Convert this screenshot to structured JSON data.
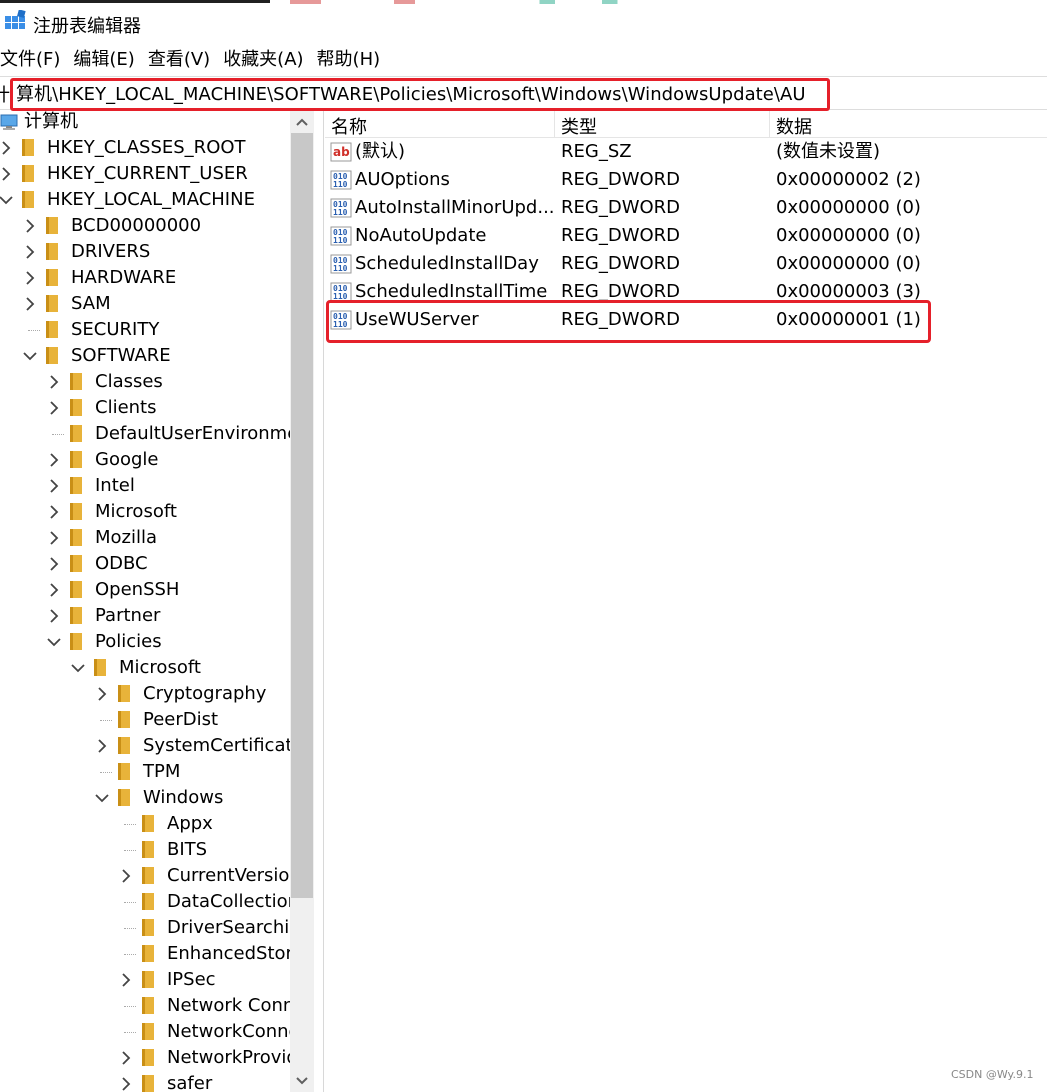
{
  "window": {
    "title": "注册表编辑器"
  },
  "menu": [
    "文件(F)",
    "编辑(E)",
    "查看(V)",
    "收藏夹(A)",
    "帮助(H)"
  ],
  "address": {
    "prefix": "计",
    "path": "算机\\HKEY_LOCAL_MACHINE\\SOFTWARE\\Policies\\Microsoft\\Windows\\WindowsUpdate\\AU"
  },
  "tree": {
    "root": "计算机",
    "nodes": [
      {
        "label": "HKEY_CLASSES_ROOT",
        "depth": 0,
        "expander": "collapsed"
      },
      {
        "label": "HKEY_CURRENT_USER",
        "depth": 0,
        "expander": "collapsed"
      },
      {
        "label": "HKEY_LOCAL_MACHINE",
        "depth": 0,
        "expander": "expanded"
      },
      {
        "label": "BCD00000000",
        "depth": 1,
        "expander": "collapsed"
      },
      {
        "label": "DRIVERS",
        "depth": 1,
        "expander": "collapsed"
      },
      {
        "label": "HARDWARE",
        "depth": 1,
        "expander": "collapsed"
      },
      {
        "label": "SAM",
        "depth": 1,
        "expander": "collapsed"
      },
      {
        "label": "SECURITY",
        "depth": 1,
        "expander": "none"
      },
      {
        "label": "SOFTWARE",
        "depth": 1,
        "expander": "expanded"
      },
      {
        "label": "Classes",
        "depth": 2,
        "expander": "collapsed"
      },
      {
        "label": "Clients",
        "depth": 2,
        "expander": "collapsed"
      },
      {
        "label": "DefaultUserEnvironment",
        "depth": 2,
        "expander": "none"
      },
      {
        "label": "Google",
        "depth": 2,
        "expander": "collapsed"
      },
      {
        "label": "Intel",
        "depth": 2,
        "expander": "collapsed"
      },
      {
        "label": "Microsoft",
        "depth": 2,
        "expander": "collapsed"
      },
      {
        "label": "Mozilla",
        "depth": 2,
        "expander": "collapsed"
      },
      {
        "label": "ODBC",
        "depth": 2,
        "expander": "collapsed"
      },
      {
        "label": "OpenSSH",
        "depth": 2,
        "expander": "collapsed"
      },
      {
        "label": "Partner",
        "depth": 2,
        "expander": "collapsed"
      },
      {
        "label": "Policies",
        "depth": 2,
        "expander": "expanded"
      },
      {
        "label": "Microsoft",
        "depth": 3,
        "expander": "expanded"
      },
      {
        "label": "Cryptography",
        "depth": 4,
        "expander": "collapsed"
      },
      {
        "label": "PeerDist",
        "depth": 4,
        "expander": "none"
      },
      {
        "label": "SystemCertificates",
        "depth": 4,
        "expander": "collapsed"
      },
      {
        "label": "TPM",
        "depth": 4,
        "expander": "none"
      },
      {
        "label": "Windows",
        "depth": 4,
        "expander": "expanded"
      },
      {
        "label": "Appx",
        "depth": 5,
        "expander": "none"
      },
      {
        "label": "BITS",
        "depth": 5,
        "expander": "none"
      },
      {
        "label": "CurrentVersion",
        "depth": 5,
        "expander": "collapsed"
      },
      {
        "label": "DataCollection",
        "depth": 5,
        "expander": "none"
      },
      {
        "label": "DriverSearching",
        "depth": 5,
        "expander": "none"
      },
      {
        "label": "EnhancedStorageDevices",
        "depth": 5,
        "expander": "none"
      },
      {
        "label": "IPSec",
        "depth": 5,
        "expander": "collapsed"
      },
      {
        "label": "Network Connections",
        "depth": 5,
        "expander": "none"
      },
      {
        "label": "NetworkConnectivityStatusIndicator",
        "depth": 5,
        "expander": "none"
      },
      {
        "label": "NetworkProvider",
        "depth": 5,
        "expander": "collapsed"
      },
      {
        "label": "safer",
        "depth": 5,
        "expander": "collapsed"
      }
    ]
  },
  "list": {
    "columns": [
      "名称",
      "类型",
      "数据"
    ],
    "rows": [
      {
        "name": "(默认)",
        "type": "REG_SZ",
        "data": "(数值未设置)",
        "icon": "string-value-icon"
      },
      {
        "name": "AUOptions",
        "type": "REG_DWORD",
        "data": "0x00000002 (2)",
        "icon": "dword-value-icon"
      },
      {
        "name": "AutoInstallMinorUpd...",
        "type": "REG_DWORD",
        "data": "0x00000000 (0)",
        "icon": "dword-value-icon"
      },
      {
        "name": "NoAutoUpdate",
        "type": "REG_DWORD",
        "data": "0x00000000 (0)",
        "icon": "dword-value-icon"
      },
      {
        "name": "ScheduledInstallDay",
        "type": "REG_DWORD",
        "data": "0x00000000 (0)",
        "icon": "dword-value-icon"
      },
      {
        "name": "ScheduledInstallTime",
        "type": "REG_DWORD",
        "data": "0x00000003 (3)",
        "icon": "dword-value-icon"
      },
      {
        "name": "UseWUServer",
        "type": "REG_DWORD",
        "data": "0x00000001 (1)",
        "icon": "dword-value-icon"
      }
    ]
  },
  "colors": {
    "highlight": "#e5202a",
    "folder": "#e8b33a",
    "dword_icon": "#2a5fb0"
  },
  "watermark": "CSDN @Wy.9.1"
}
